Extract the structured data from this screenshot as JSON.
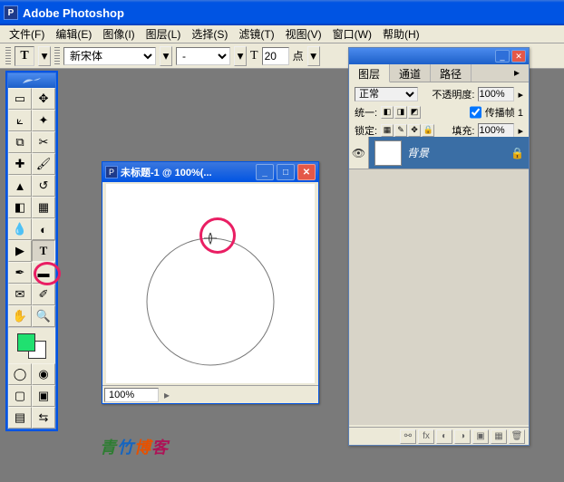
{
  "app": {
    "title": "Adobe Photoshop"
  },
  "menus": [
    "文件(F)",
    "编辑(E)",
    "图像(I)",
    "图层(L)",
    "选择(S)",
    "滤镜(T)",
    "视图(V)",
    "窗口(W)",
    "帮助(H)"
  ],
  "options": {
    "tool_glyph": "T",
    "font_family": "新宋体",
    "font_style": "-",
    "size_prefix": "T",
    "font_size": "20",
    "unit": "点"
  },
  "document": {
    "title": "未标题-1 @ 100%(...",
    "zoom": "100%"
  },
  "layers_panel": {
    "tabs": [
      "图层",
      "通道",
      "路径"
    ],
    "blend_mode": "正常",
    "opacity_label": "不透明度:",
    "opacity": "100%",
    "unify_label": "统一:",
    "propagate": "传播帧 1",
    "lock_label": "锁定:",
    "fill_label": "填充:",
    "fill": "100%",
    "layers": [
      {
        "name": "背景"
      }
    ]
  },
  "colors": {
    "foreground": "#20E070",
    "background": "#FFFFFF"
  },
  "watermark": [
    "青",
    "竹",
    "博",
    "客"
  ]
}
